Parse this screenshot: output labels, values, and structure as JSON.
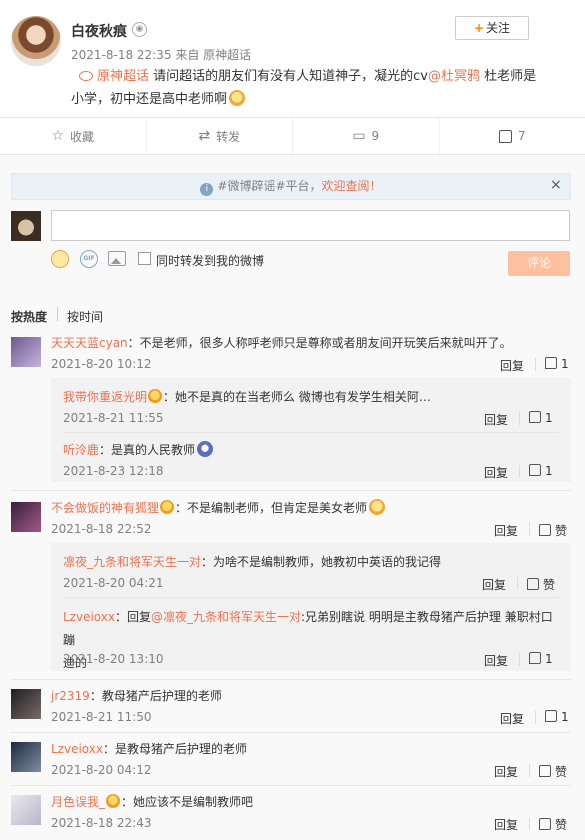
{
  "post": {
    "author": "白夜秋痕",
    "meta": "2021-8-18 22:35 来自 原神超话",
    "follow_label": "关注",
    "topic": "原神超话",
    "text_a": " 请问超话的朋友们有没有人知道神子，凝光的cv",
    "mention": "@杜冥鸦",
    "text_b": " 杜老师是",
    "text_c": "小学，初中还是高中老师啊"
  },
  "actions": {
    "favorite": "收藏",
    "repost": "转发",
    "comments": "9",
    "likes": "7"
  },
  "notice": {
    "text": "#微博辟谣#平台，",
    "welcome": "欢迎查阅！",
    "close": "×"
  },
  "composer": {
    "repost_label": "同时转发到我的微博",
    "submit": "评论",
    "gif": "GIF"
  },
  "sort": {
    "hot": "按热度",
    "time": "按时间"
  },
  "comments": [
    {
      "name": "天天天蓝cyan",
      "text": "：不是老师，很多人称呼老师只是尊称或者朋友间开玩笑后来就叫开了。",
      "time": "2021-8-20 10:12",
      "reply": "回复",
      "like": "1"
    },
    {
      "name": "我带你重返光明",
      "text": "：她不是真的在当老师么 微博也有发学生相关阿…",
      "time": "2021-8-21 11:55",
      "reply": "回复",
      "like": "1"
    },
    {
      "name": "听泠鹿",
      "text": "：是真的人民教师",
      "time": "2021-8-23 12:18",
      "reply": "回复",
      "like": "1"
    },
    {
      "name": "不会做饭的神有狐狸",
      "text": "：不是编制老师，但肯定是美女老师",
      "time": "2021-8-18 22:52",
      "reply": "回复",
      "like": "赞"
    },
    {
      "name": "凛夜_九条和将军天生一对",
      "text": "：为啥不是编制教师，她教初中英语的我记得",
      "time": "2021-8-20 04:21",
      "reply": "回复",
      "like": "赞"
    },
    {
      "name": "Lzveioxx",
      "text_pre": "：回复",
      "mention": "@凛夜_九条和将军天生一对",
      "text_line1": ":兄弟别瞎说 明明是主教母猪产后护理 兼职村口蹦",
      "text_line2": "迪的",
      "time": "2021-8-20 13:10",
      "reply": "回复",
      "like": "1"
    },
    {
      "name": "jr2319",
      "text": "：教母猪产后护理的老师",
      "time": "2021-8-21 11:50",
      "reply": "回复",
      "like": "1"
    },
    {
      "name": "Lzveioxx",
      "text": "：是教母猪产后护理的老师",
      "time": "2021-8-20 04:12",
      "reply": "回复",
      "like": "赞"
    },
    {
      "name": "月色误我_",
      "text": "：她应该不是编制教师吧",
      "time": "2021-8-18 22:43",
      "reply": "回复",
      "like": "赞"
    }
  ]
}
